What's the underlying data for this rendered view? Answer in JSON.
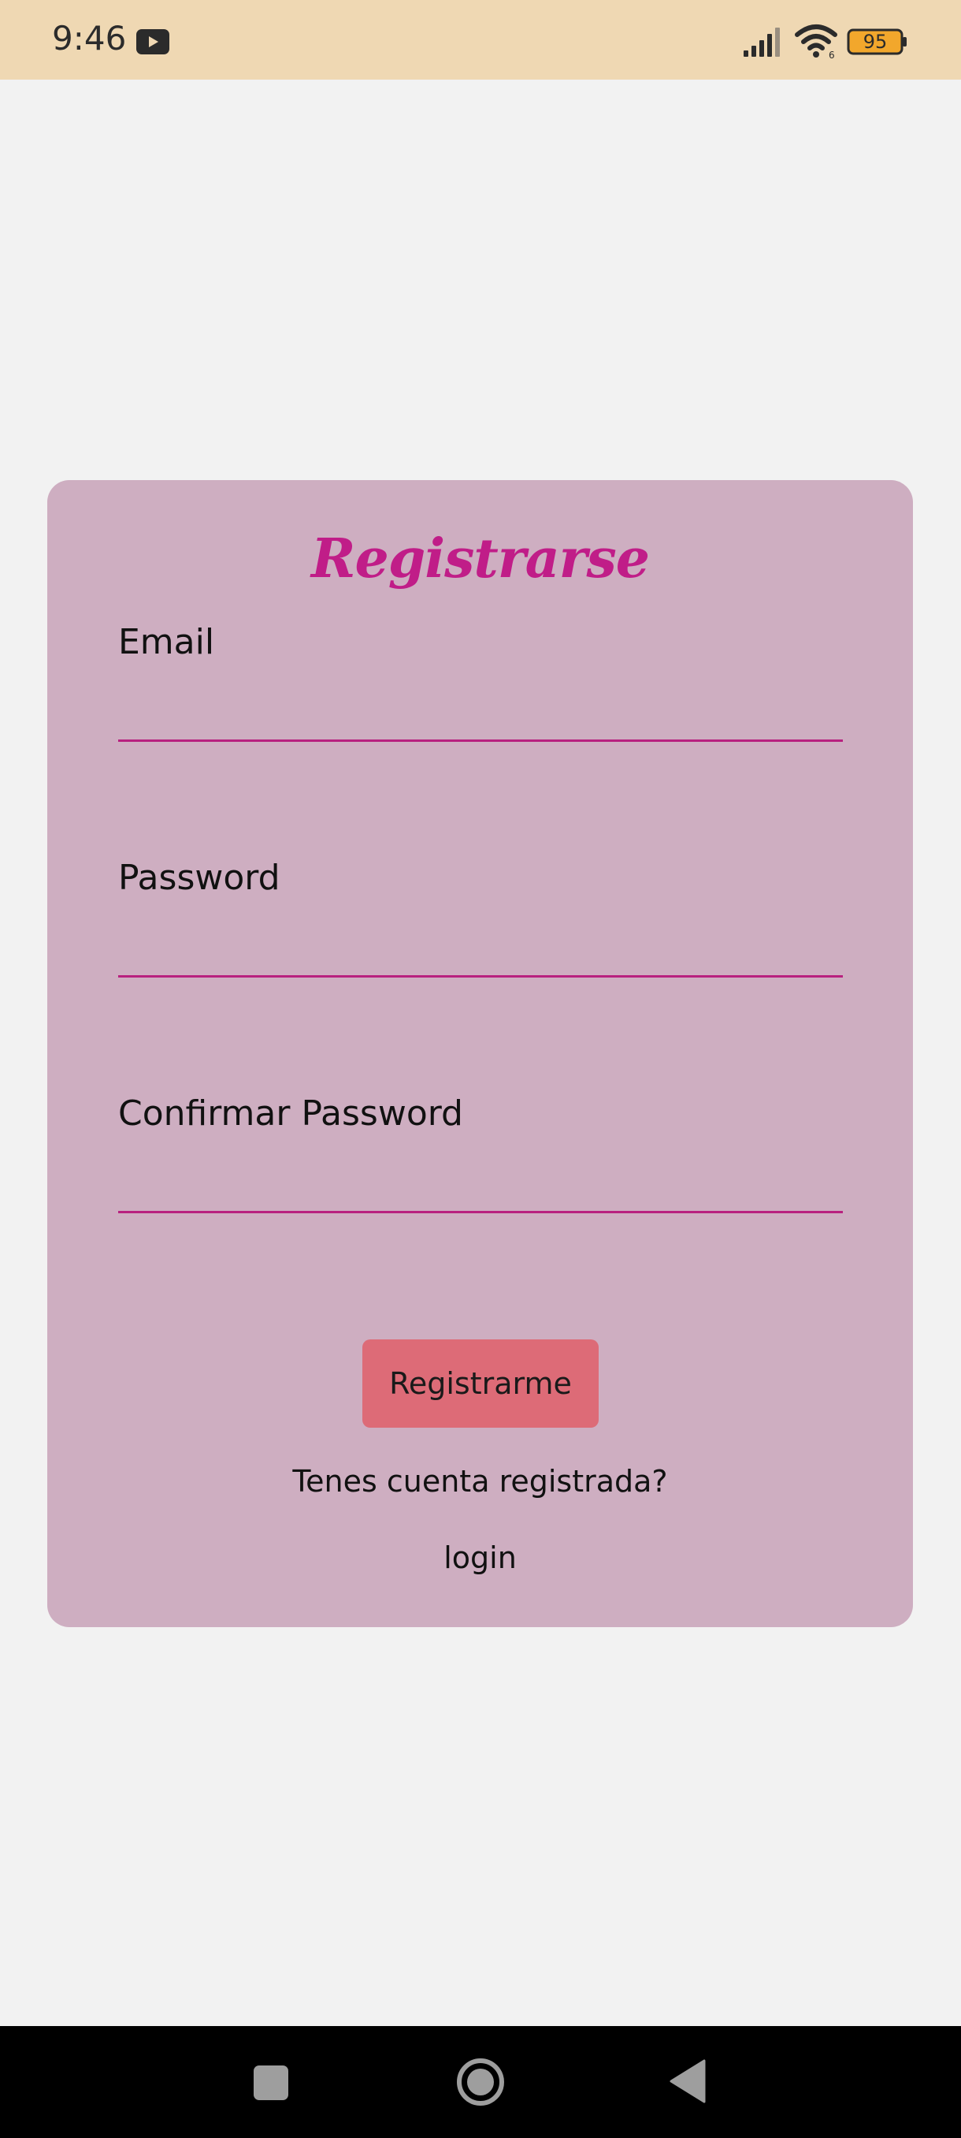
{
  "status_bar": {
    "time": "9:46",
    "battery": "95",
    "icons": [
      "youtube-icon",
      "signal-icon",
      "wifi-icon",
      "battery-icon"
    ]
  },
  "form": {
    "title": "Registrarse",
    "email_label": "Email",
    "email_value": "",
    "password_label": "Password",
    "password_value": "",
    "confirm_label": "Confirmar Password",
    "confirm_value": "",
    "submit_label": "Registrarme",
    "question": "Tenes cuenta registrada?",
    "login_label": "login"
  },
  "colors": {
    "status_bar_bg": "#efd8b3",
    "page_bg": "#f2f2f2",
    "card_bg": "#ceaec1",
    "title_color": "#c01d88",
    "underline_color": "#b8217f",
    "button_bg": "#dd6b77"
  },
  "nav_bar": {
    "icons": [
      "recents-icon",
      "home-icon",
      "back-icon"
    ]
  }
}
